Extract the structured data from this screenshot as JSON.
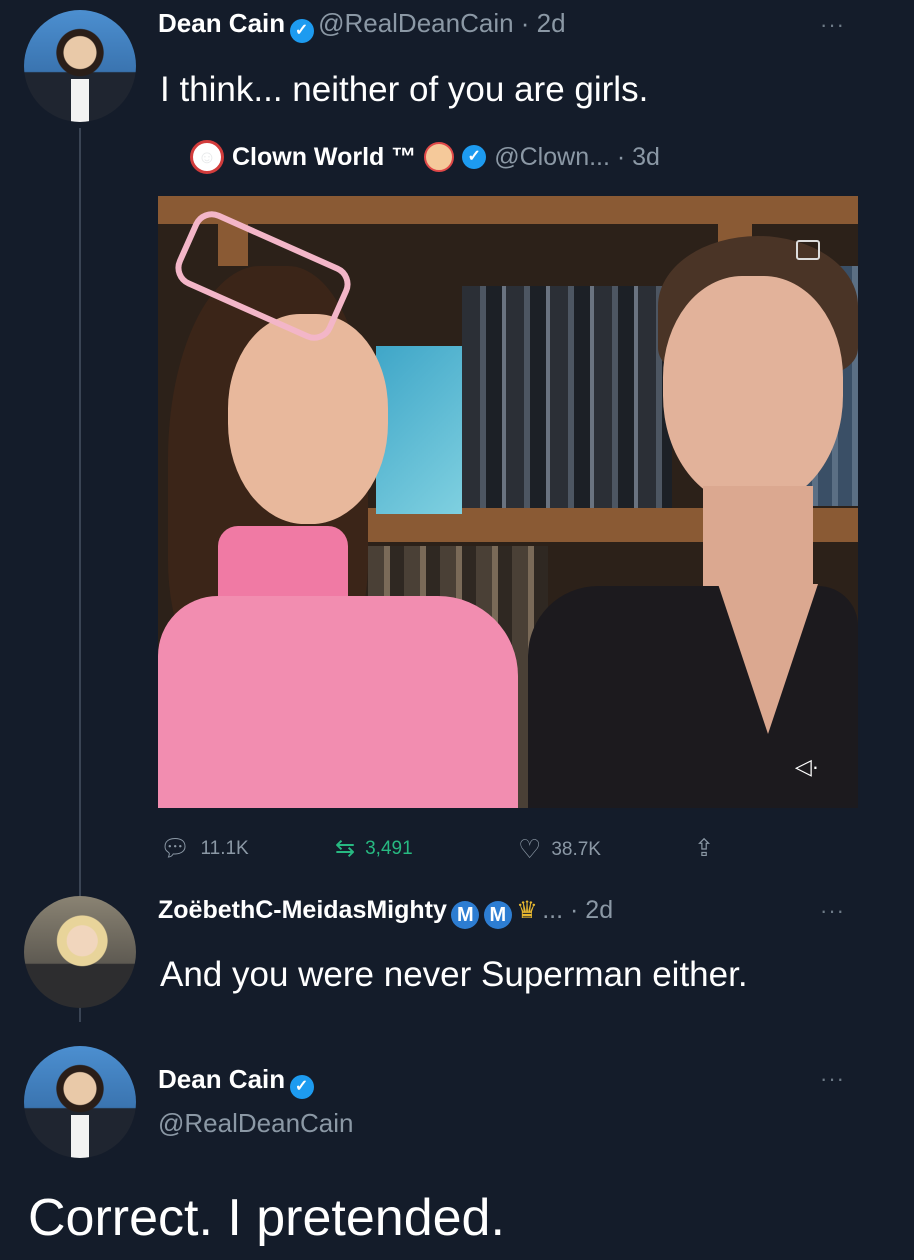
{
  "tweet1": {
    "display_name": "Dean Cain",
    "handle_time": "@RealDeanCain · 2d",
    "text": "I think... neither of you are girls.",
    "more": "···"
  },
  "quote": {
    "display_name": "Clown World ™",
    "handle_time": "@Clown... · 3d"
  },
  "actions": {
    "replies": "11.1K",
    "retweets": "3,491",
    "likes": "38.7K"
  },
  "reply": {
    "display_name": "ZoëbethC-MeidasMighty",
    "badge1": "M",
    "badge2": "M",
    "ellipsis_time": "... · 2d",
    "text": "And you were never Superman either.",
    "more": "···"
  },
  "tweet3": {
    "display_name": "Dean Cain",
    "handle": "@RealDeanCain",
    "text": "Correct. I pretended.",
    "more": "···"
  },
  "colors": {
    "background": "#141c2a",
    "verified": "#1d9bf0",
    "muted_text": "#8b98a5"
  }
}
